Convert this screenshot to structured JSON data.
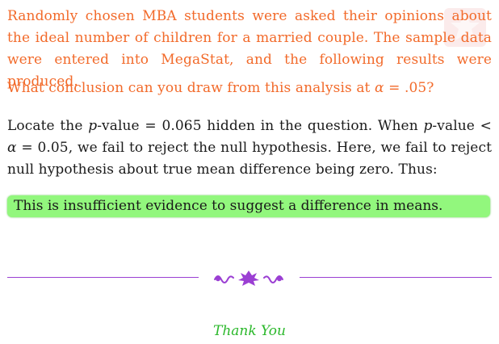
{
  "question": {
    "intro": "Randomly chosen MBA students were asked their opinions about the ideal number of children for a married couple. The sample data were entered into MegaStat, and the following results were produced.",
    "prompt_before": "What conclusion can you draw from this analysis at ",
    "alpha_symbol": "α",
    "prompt_after": " = .05?"
  },
  "answer": {
    "t1": "Locate the ",
    "p1": "p",
    "t2": "-value = 0.065 hidden in the question. When ",
    "p2": "p",
    "t3": "-value < ",
    "alpha": "α",
    "t4": " = 0.05, we fail to reject the null hypothesis. Here, we fail to reject null hypothesis about true mean difference being zero. Thus:"
  },
  "conclusion": "This is insufficient evidence to suggest a difference in means.",
  "closing": "Thank You",
  "colors": {
    "question_text": "#f26a2a",
    "highlight_box": "#92f77d",
    "divider": "#9b3fd3",
    "closing_text": "#2bb82b"
  },
  "icons": {
    "divider_ornament": "flourish-ornament-icon",
    "corner": "corner-decoration-icon"
  }
}
